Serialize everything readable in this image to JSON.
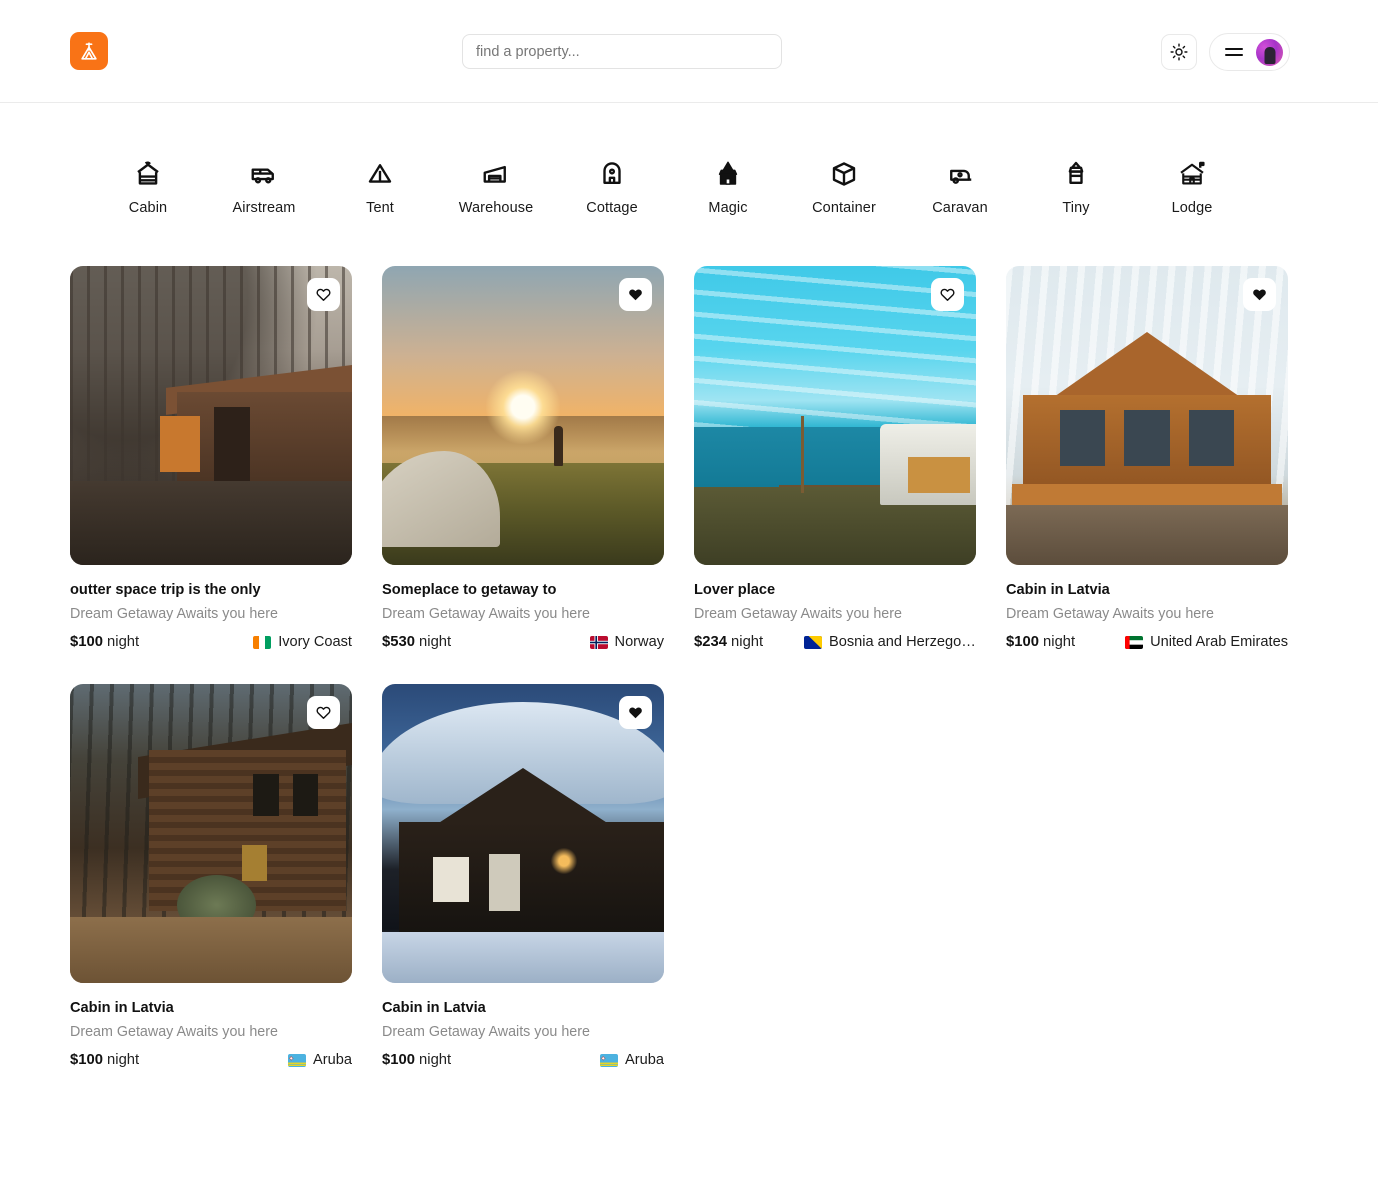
{
  "header": {
    "logo_icon": "tent-logo-icon",
    "logo_color": "#f97316",
    "search": {
      "placeholder": "find a property...",
      "value": ""
    },
    "theme_toggle_icon": "sun-icon",
    "menu_icon": "hamburger-menu-icon",
    "avatar_icon": "user-avatar"
  },
  "categories": [
    {
      "label": "Cabin",
      "icon": "cabin-icon"
    },
    {
      "label": "Airstream",
      "icon": "airstream-van-icon"
    },
    {
      "label": "Tent",
      "icon": "tent-icon"
    },
    {
      "label": "Warehouse",
      "icon": "warehouse-icon"
    },
    {
      "label": "Cottage",
      "icon": "cottage-icon"
    },
    {
      "label": "Magic",
      "icon": "magic-house-icon"
    },
    {
      "label": "Container",
      "icon": "container-box-icon"
    },
    {
      "label": "Caravan",
      "icon": "caravan-trailer-icon"
    },
    {
      "label": "Tiny",
      "icon": "tiny-house-icon"
    },
    {
      "label": "Lodge",
      "icon": "lodge-cabin-icon"
    }
  ],
  "listings": [
    {
      "title": "outter space trip is the only",
      "subtitle": "Dream Getaway Awaits you here",
      "price": "$100",
      "price_unit": "night",
      "location": "Ivory Coast",
      "favorited": false,
      "photo_alt": "dark forest cabin among bare trees"
    },
    {
      "title": "Someplace to getaway to",
      "subtitle": "Dream Getaway Awaits you here",
      "price": "$530",
      "price_unit": "night",
      "location": "Norway",
      "favorited": true,
      "photo_alt": "tent and hiker at golden sunrise on a hill"
    },
    {
      "title": "Lover place",
      "subtitle": "Dream Getaway Awaits you here",
      "price": "$234",
      "price_unit": "night",
      "location": "Bosnia and Herzegovi ...",
      "favorited": false,
      "photo_alt": "caravan by the sea under bright cyan sky"
    },
    {
      "title": "Cabin in Latvia",
      "subtitle": "Dream Getaway Awaits you here",
      "price": "$100",
      "price_unit": "night",
      "location": "United Arab Emirates",
      "favorited": true,
      "photo_alt": "large timber lodge seen from below"
    },
    {
      "title": "Cabin in Latvia",
      "subtitle": "Dream Getaway Awaits you here",
      "price": "$100",
      "price_unit": "night",
      "location": "Aruba",
      "favorited": false,
      "photo_alt": "log cabin in woods at dusk"
    },
    {
      "title": "Cabin in Latvia",
      "subtitle": "Dream Getaway Awaits you here",
      "price": "$100",
      "price_unit": "night",
      "location": "Aruba",
      "favorited": true,
      "photo_alt": "snow covered cabin with lit windows"
    }
  ]
}
